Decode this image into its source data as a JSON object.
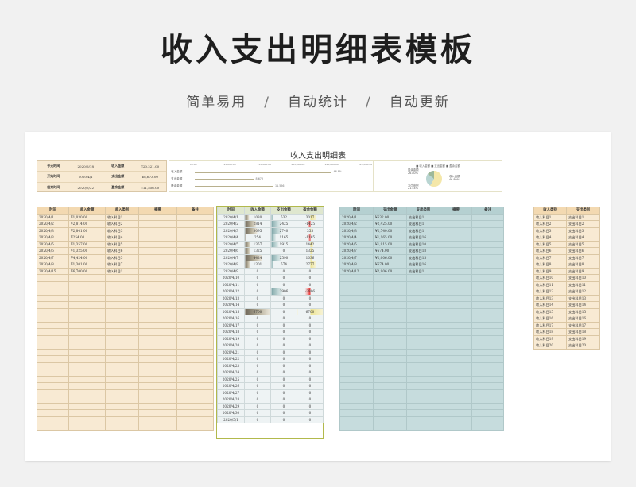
{
  "hero": {
    "title": "收入支出明细表模板",
    "tags": [
      "简单易用",
      "自动统计",
      "自动更新"
    ],
    "sep": "/"
  },
  "sheet": {
    "title": "收入支出明细表"
  },
  "summary": [
    {
      "l1": "今天时间",
      "v1": "2020/6/18",
      "l2": "收入金额",
      "v2": "¥20,221.00"
    },
    {
      "l1": "开始时间",
      "v1": "2020/4/1",
      "l2": "支出金额",
      "v2": "¥8,673.00"
    },
    {
      "l1": "结束时间",
      "v1": "2020/5/22",
      "l2": "盈余金额",
      "v2": "¥11,556.00"
    }
  ],
  "bar_chart": {
    "ticks": [
      "¥0.00",
      "¥5,000.00",
      "¥10,000.00",
      "¥15,000.00",
      "¥20,000.00",
      "¥25,000.00"
    ],
    "bars": [
      {
        "label": "收入金额",
        "value": 20221,
        "text": "46.8%"
      },
      {
        "label": "支出金额",
        "value": 8673,
        "text": "8,673"
      },
      {
        "label": "盈余金额",
        "value": 11556,
        "text": "11,556"
      }
    ],
    "bar_color": "#b8b08e"
  },
  "pie_chart": {
    "legend": "■ 收入金额 ■ 支出金额 ■ 盈余金额",
    "labels": [
      "盈余金额\n26.80%",
      "收入金额\n46.80%",
      "支出金额\n21.44%"
    ],
    "colors": [
      "#f4e7a9",
      "#b9d5d2",
      "#9db89a"
    ]
  },
  "income_table": {
    "headers": [
      "时间",
      "收入金额",
      "收入类别",
      "摘要",
      "备注"
    ],
    "rows": [
      [
        "2020/4/1",
        "¥1,030.00",
        "收入科目1",
        "",
        ""
      ],
      [
        "2020/4/2",
        "¥2,814.00",
        "收入科目2",
        "",
        ""
      ],
      [
        "2020/4/3",
        "¥2,841.00",
        "收入科目3",
        "",
        ""
      ],
      [
        "2020/4/3",
        "¥254.00",
        "收入科目4",
        "",
        ""
      ],
      [
        "2020/4/5",
        "¥1,357.00",
        "收入科目5",
        "",
        ""
      ],
      [
        "2020/4/6",
        "¥1,325.00",
        "收入科目6",
        "",
        ""
      ],
      [
        "2020/4/7",
        "¥4,424.00",
        "收入科目5",
        "",
        ""
      ],
      [
        "2020/4/8",
        "¥1,301.00",
        "收入科目7",
        "",
        ""
      ],
      [
        "2020/4/15",
        "¥6,700.00",
        "收入科目1",
        "",
        ""
      ]
    ],
    "total_rows": 32
  },
  "summary_table": {
    "headers": [
      "时间",
      "收入金额",
      "支出金额",
      "盈余金额"
    ],
    "rows": [
      [
        "2020/4/1",
        "1030",
        "532",
        "3017"
      ],
      [
        "2020/4/2",
        "2814",
        "2425",
        "-1425"
      ],
      [
        "2020/4/3",
        "3095",
        "2740",
        "355"
      ],
      [
        "2020/4/4",
        "254",
        "1165",
        "-1165"
      ],
      [
        "2020/4/5",
        "1357",
        "1915",
        "1442"
      ],
      [
        "2020/4/6",
        "1325",
        "0",
        "1325"
      ],
      [
        "2020/4/7",
        "4424",
        "2590",
        "1036"
      ],
      [
        "2020/4/8",
        "1301",
        "574",
        "2777"
      ],
      [
        "2020/4/9",
        "0",
        "0",
        "0"
      ],
      [
        "2020/4/10",
        "0",
        "0",
        "0"
      ],
      [
        "2020/4/11",
        "0",
        "0",
        "0"
      ],
      [
        "2020/4/12",
        "0",
        "2906",
        "-2906"
      ],
      [
        "2020/4/13",
        "0",
        "0",
        "0"
      ],
      [
        "2020/4/14",
        "0",
        "0",
        "0"
      ],
      [
        "2020/4/15",
        "6700",
        "0",
        "6700"
      ],
      [
        "2020/4/16",
        "0",
        "0",
        "0"
      ],
      [
        "2020/4/17",
        "0",
        "0",
        "0"
      ],
      [
        "2020/4/18",
        "0",
        "0",
        "0"
      ],
      [
        "2020/4/19",
        "0",
        "0",
        "0"
      ],
      [
        "2020/4/20",
        "0",
        "0",
        "0"
      ],
      [
        "2020/4/21",
        "0",
        "0",
        "0"
      ],
      [
        "2020/4/22",
        "0",
        "0",
        "0"
      ],
      [
        "2020/4/23",
        "0",
        "0",
        "0"
      ],
      [
        "2020/4/24",
        "0",
        "0",
        "0"
      ],
      [
        "2020/4/25",
        "0",
        "0",
        "0"
      ],
      [
        "2020/4/26",
        "0",
        "0",
        "0"
      ],
      [
        "2020/4/27",
        "0",
        "0",
        "0"
      ],
      [
        "2020/4/28",
        "0",
        "0",
        "0"
      ],
      [
        "2020/4/29",
        "0",
        "0",
        "0"
      ],
      [
        "2020/4/30",
        "0",
        "0",
        "0"
      ],
      [
        "2020/5/1",
        "0",
        "0",
        "0"
      ]
    ],
    "max_value": 6700
  },
  "expense_table": {
    "headers": [
      "时间",
      "支出金额",
      "支出类别",
      "摘要",
      "备注"
    ],
    "rows": [
      [
        "2020/4/1",
        "¥532.00",
        "支出科目1",
        "",
        ""
      ],
      [
        "2020/4/2",
        "¥2,425.00",
        "支出科目1",
        "",
        ""
      ],
      [
        "2020/4/3",
        "¥2,740.00",
        "支出科目1",
        "",
        ""
      ],
      [
        "2020/4/4",
        "¥1,165.00",
        "支出科目16",
        "",
        ""
      ],
      [
        "2020/4/5",
        "¥1,915.00",
        "支出科目10",
        "",
        ""
      ],
      [
        "2020/4/7",
        "¥574.00",
        "支出科目18",
        "",
        ""
      ],
      [
        "2020/4/7",
        "¥2,006.00",
        "支出科目15",
        "",
        ""
      ],
      [
        "2020/4/8",
        "¥574.00",
        "支出科目16",
        "",
        ""
      ],
      [
        "2020/4/12",
        "¥2,906.00",
        "支出科目1",
        "",
        ""
      ]
    ],
    "total_rows": 32
  },
  "category_table": {
    "headers": [
      "收入类别",
      "支出类别"
    ],
    "rows": [
      [
        "收入科目1",
        "支出科目1"
      ],
      [
        "收入科目2",
        "支出科目2"
      ],
      [
        "收入科目3",
        "支出科目3"
      ],
      [
        "收入科目4",
        "支出科目4"
      ],
      [
        "收入科目5",
        "支出科目5"
      ],
      [
        "收入科目6",
        "支出科目6"
      ],
      [
        "收入科目7",
        "支出科目7"
      ],
      [
        "收入科目8",
        "支出科目8"
      ],
      [
        "收入科目9",
        "支出科目9"
      ],
      [
        "收入科目10",
        "支出科目10"
      ],
      [
        "收入科目11",
        "支出科目11"
      ],
      [
        "收入科目12",
        "支出科目12"
      ],
      [
        "收入科目13",
        "支出科目13"
      ],
      [
        "收入科目14",
        "支出科目14"
      ],
      [
        "收入科目15",
        "支出科目15"
      ],
      [
        "收入科目16",
        "支出科目16"
      ],
      [
        "收入科目17",
        "支出科目17"
      ],
      [
        "收入科目18",
        "支出科目18"
      ],
      [
        "收入科目19",
        "支出科目19"
      ],
      [
        "收入科目20",
        "支出科目20"
      ]
    ]
  }
}
